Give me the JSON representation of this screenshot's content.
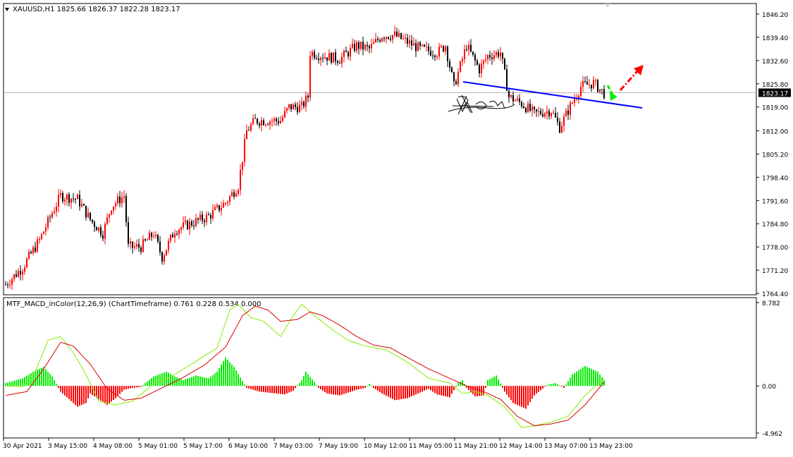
{
  "window": {
    "symbol_info": "XAUUSD,H1  1825.66 1826.37 1822.28 1823.17",
    "menu_icon": "triangle-down-icon"
  },
  "colors": {
    "bull_candle": "#ff0000",
    "bear_candle": "#000000",
    "trendline": "#0000ff",
    "arrow_green": "#00ee00",
    "arrow_red": "#ff0000",
    "hist_up": "#00ee00",
    "hist_down": "#ff0000",
    "macd_line": "#88ee00",
    "signal_line": "#dd0000",
    "current_price_bg": "#000000"
  },
  "chart_data": [
    {
      "type": "candlestick",
      "title": "XAUUSD,H1  1825.66 1826.37 1822.28 1823.17",
      "y_ticks": [
        "1846.20",
        "1839.40",
        "1832.60",
        "1825.80",
        "1819.00",
        "1812.00",
        "1805.20",
        "1798.40",
        "1791.60",
        "1784.80",
        "1778.00",
        "1771.20",
        "1764.40"
      ],
      "ylim": [
        1764.4,
        1846.2
      ],
      "current_price": "1823.17",
      "x_ticks": [
        "30 Apr 2021",
        "3 May 15:00",
        "4 May 08:00",
        "5 May 01:00",
        "5 May 17:00",
        "6 May 10:00",
        "7 May 03:00",
        "7 May 19:00",
        "10 May 12:00",
        "11 May 05:00",
        "11 May 21:00",
        "12 May 14:00",
        "13 May 07:00",
        "13 May 23:00"
      ],
      "anchors": [
        [
          0,
          1767
        ],
        [
          8,
          1772
        ],
        [
          16,
          1780
        ],
        [
          22,
          1788
        ],
        [
          26,
          1793
        ],
        [
          34,
          1792
        ],
        [
          40,
          1786
        ],
        [
          46,
          1782
        ],
        [
          50,
          1790
        ],
        [
          56,
          1793
        ],
        [
          58,
          1778
        ],
        [
          64,
          1778
        ],
        [
          70,
          1782
        ],
        [
          74,
          1775
        ],
        [
          80,
          1783
        ],
        [
          88,
          1785
        ],
        [
          96,
          1787
        ],
        [
          104,
          1791
        ],
        [
          110,
          1796
        ],
        [
          114,
          1812
        ],
        [
          118,
          1815
        ],
        [
          124,
          1815
        ],
        [
          130,
          1815
        ],
        [
          134,
          1819
        ],
        [
          140,
          1819
        ],
        [
          143,
          1822
        ],
        [
          144,
          1835
        ],
        [
          150,
          1834
        ],
        [
          158,
          1833
        ],
        [
          166,
          1837
        ],
        [
          172,
          1836
        ],
        [
          178,
          1840
        ],
        [
          184,
          1840
        ],
        [
          190,
          1838
        ],
        [
          196,
          1836
        ],
        [
          204,
          1835
        ],
        [
          208,
          1837
        ],
        [
          212,
          1825
        ],
        [
          218,
          1837
        ],
        [
          224,
          1830
        ],
        [
          228,
          1834
        ],
        [
          234,
          1835
        ],
        [
          238,
          1822
        ],
        [
          244,
          1820
        ],
        [
          250,
          1817
        ],
        [
          258,
          1818
        ],
        [
          262,
          1813
        ],
        [
          266,
          1818
        ],
        [
          272,
          1825
        ],
        [
          278,
          1826
        ],
        [
          283,
          1823
        ]
      ]
    },
    {
      "type": "line",
      "indicator_label": "MTF_MACD_inColor(12,26,9) (ChartTimeframe) 0.761 0.228 0.534 0.000",
      "y_ticks": [
        "8.782",
        "0.00",
        "-4.962"
      ],
      "ylim": [
        -4.962,
        8.782
      ],
      "hist_anchors": [
        [
          0,
          0.3
        ],
        [
          8,
          0.8
        ],
        [
          14,
          1.6
        ],
        [
          18,
          2.0
        ],
        [
          22,
          1.0
        ],
        [
          24,
          0.2
        ],
        [
          26,
          -0.6
        ],
        [
          30,
          -1.4
        ],
        [
          34,
          -2.2
        ],
        [
          38,
          -1.8
        ],
        [
          40,
          -0.8
        ],
        [
          44,
          -1.4
        ],
        [
          48,
          -2.0
        ],
        [
          52,
          -1.3
        ],
        [
          56,
          -0.4
        ],
        [
          60,
          -0.2
        ],
        [
          64,
          -0.1
        ],
        [
          66,
          0.3
        ],
        [
          70,
          1.0
        ],
        [
          76,
          1.5
        ],
        [
          80,
          1.0
        ],
        [
          84,
          0.6
        ],
        [
          90,
          1.1
        ],
        [
          96,
          0.8
        ],
        [
          100,
          1.5
        ],
        [
          104,
          3.0
        ],
        [
          108,
          2.0
        ],
        [
          112,
          0.5
        ],
        [
          114,
          -0.2
        ],
        [
          120,
          -0.6
        ],
        [
          128,
          -0.8
        ],
        [
          132,
          -0.9
        ],
        [
          136,
          -0.5
        ],
        [
          140,
          0.6
        ],
        [
          142,
          1.5
        ],
        [
          146,
          0.4
        ],
        [
          148,
          -0.2
        ],
        [
          152,
          -0.8
        ],
        [
          158,
          -1.0
        ],
        [
          162,
          -0.7
        ],
        [
          166,
          -0.4
        ],
        [
          170,
          -0.2
        ],
        [
          172,
          0.2
        ],
        [
          174,
          -0.2
        ],
        [
          178,
          -0.8
        ],
        [
          184,
          -1.5
        ],
        [
          190,
          -1.3
        ],
        [
          196,
          -0.7
        ],
        [
          200,
          -0.3
        ],
        [
          204,
          -0.9
        ],
        [
          210,
          -1.2
        ],
        [
          214,
          0.3
        ],
        [
          216,
          0.6
        ],
        [
          218,
          -0.2
        ],
        [
          222,
          -1.1
        ],
        [
          226,
          -1.0
        ],
        [
          228,
          0.6
        ],
        [
          232,
          1.1
        ],
        [
          236,
          -0.6
        ],
        [
          240,
          -1.8
        ],
        [
          246,
          -2.4
        ],
        [
          250,
          -1.0
        ],
        [
          256,
          0.1
        ],
        [
          260,
          0.3
        ],
        [
          264,
          -0.2
        ],
        [
          268,
          1.2
        ],
        [
          274,
          2.1
        ],
        [
          280,
          1.5
        ],
        [
          283,
          0.6
        ]
      ],
      "series": [
        {
          "anchors": [
            [
              0,
              0.0
            ],
            [
              8,
              -0.1
            ],
            [
              14,
              1.5
            ],
            [
              20,
              4.8
            ],
            [
              26,
              5.2
            ],
            [
              32,
              3.5
            ],
            [
              38,
              1.2
            ],
            [
              44,
              -1.6
            ],
            [
              52,
              -2.0
            ],
            [
              60,
              -1.6
            ],
            [
              70,
              0.2
            ],
            [
              80,
              1.2
            ],
            [
              90,
              2.6
            ],
            [
              100,
              4.0
            ],
            [
              106,
              8.0
            ],
            [
              110,
              8.6
            ],
            [
              116,
              7.2
            ],
            [
              122,
              6.8
            ],
            [
              130,
              5.2
            ],
            [
              136,
              7.4
            ],
            [
              140,
              8.6
            ],
            [
              146,
              7.4
            ],
            [
              154,
              6.0
            ],
            [
              162,
              4.8
            ],
            [
              170,
              4.2
            ],
            [
              180,
              3.8
            ],
            [
              190,
              2.5
            ],
            [
              200,
              0.8
            ],
            [
              210,
              0.3
            ],
            [
              216,
              -0.8
            ],
            [
              222,
              -0.6
            ],
            [
              228,
              -1.0
            ],
            [
              236,
              -2.2
            ],
            [
              244,
              -4.4
            ],
            [
              250,
              -4.2
            ],
            [
              258,
              -3.8
            ],
            [
              266,
              -3.2
            ],
            [
              274,
              -1.0
            ],
            [
              280,
              0.2
            ],
            [
              283,
              0.8
            ]
          ]
        },
        {
          "anchors": [
            [
              0,
              -1.0
            ],
            [
              10,
              -0.6
            ],
            [
              18,
              1.8
            ],
            [
              26,
              4.6
            ],
            [
              32,
              4.2
            ],
            [
              40,
              2.3
            ],
            [
              48,
              -0.3
            ],
            [
              56,
              -1.5
            ],
            [
              64,
              -1.3
            ],
            [
              74,
              -0.2
            ],
            [
              84,
              0.9
            ],
            [
              94,
              2.2
            ],
            [
              104,
              4.1
            ],
            [
              112,
              7.4
            ],
            [
              118,
              8.4
            ],
            [
              124,
              8.0
            ],
            [
              130,
              6.8
            ],
            [
              138,
              7.0
            ],
            [
              144,
              7.8
            ],
            [
              150,
              7.4
            ],
            [
              158,
              6.4
            ],
            [
              166,
              5.2
            ],
            [
              174,
              4.3
            ],
            [
              182,
              4.0
            ],
            [
              190,
              3.0
            ],
            [
              200,
              1.8
            ],
            [
              210,
              0.8
            ],
            [
              218,
              0.0
            ],
            [
              226,
              -0.6
            ],
            [
              234,
              -1.4
            ],
            [
              242,
              -3.2
            ],
            [
              250,
              -4.2
            ],
            [
              258,
              -4.0
            ],
            [
              266,
              -3.6
            ],
            [
              274,
              -2.0
            ],
            [
              280,
              -0.4
            ],
            [
              283,
              0.4
            ]
          ]
        }
      ]
    }
  ]
}
